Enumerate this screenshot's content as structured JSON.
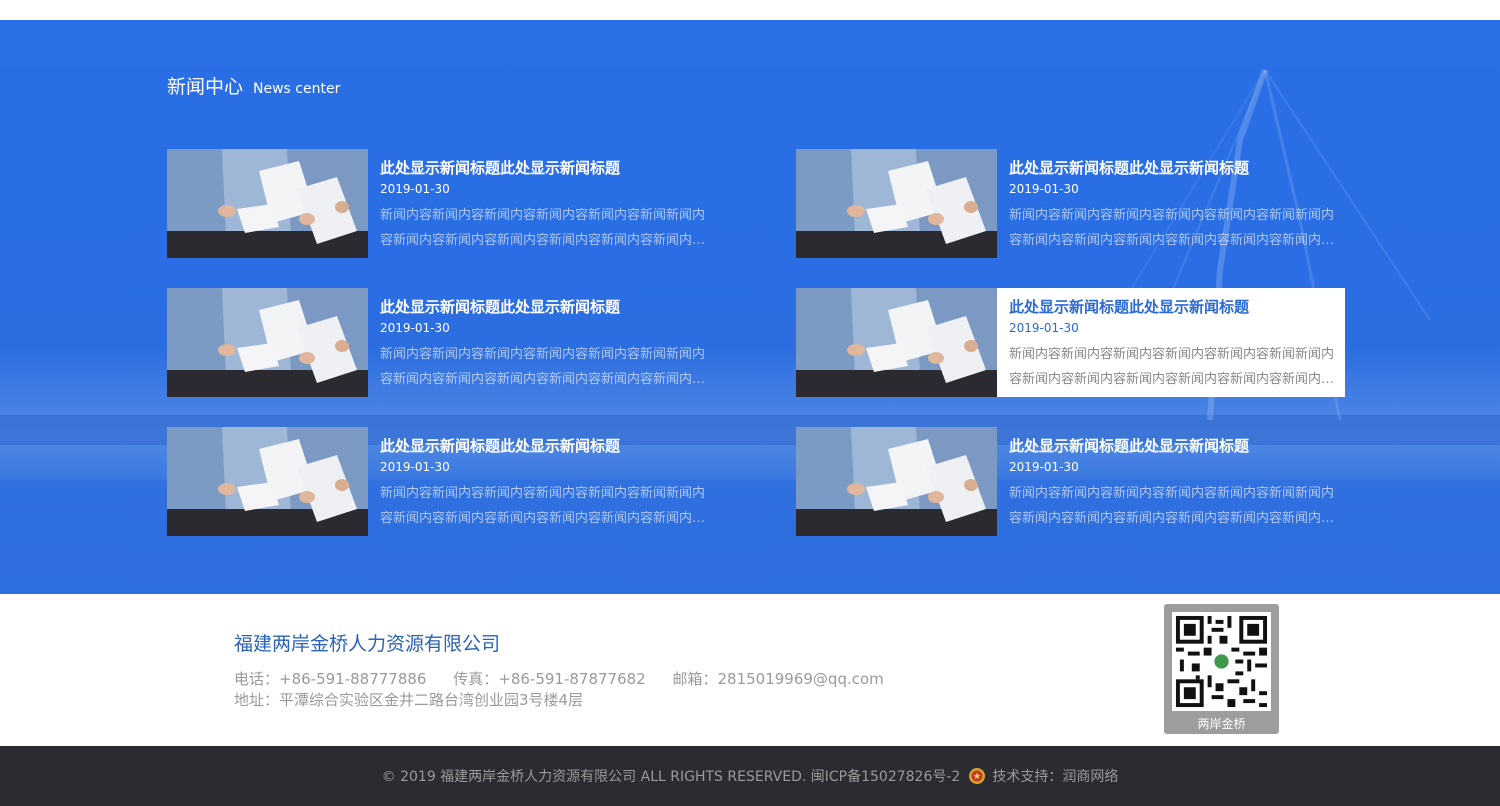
{
  "news": {
    "title_cn": "新闻中心",
    "title_en": "News center",
    "items": [
      {
        "title": "此处显示新闻标题此处显示新闻标题",
        "date": "2019-01-30",
        "summary": "新闻内容新闻内容新闻内容新闻内容新闻内容新闻新闻内容新闻内容新闻内容新闻内容新闻内容新闻内容新闻内容新闻",
        "active": false
      },
      {
        "title": "此处显示新闻标题此处显示新闻标题",
        "date": "2019-01-30",
        "summary": "新闻内容新闻内容新闻内容新闻内容新闻内容新闻新闻内容新闻内容新闻内容新闻内容新闻内容新闻内容新闻内容新闻",
        "active": false
      },
      {
        "title": "此处显示新闻标题此处显示新闻标题",
        "date": "2019-01-30",
        "summary": "新闻内容新闻内容新闻内容新闻内容新闻内容新闻新闻内容新闻内容新闻内容新闻内容新闻内容新闻内容新闻内容新闻",
        "active": false
      },
      {
        "title": "此处显示新闻标题此处显示新闻标题",
        "date": "2019-01-30",
        "summary": "新闻内容新闻内容新闻内容新闻内容新闻内容新闻新闻内容新闻内容新闻内容新闻内容新闻内容新闻内容新闻内容新闻",
        "active": true
      },
      {
        "title": "此处显示新闻标题此处显示新闻标题",
        "date": "2019-01-30",
        "summary": "新闻内容新闻内容新闻内容新闻内容新闻内容新闻新闻内容新闻内容新闻内容新闻内容新闻内容新闻内容新闻内容新闻",
        "active": false
      },
      {
        "title": "此处显示新闻标题此处显示新闻标题",
        "date": "2019-01-30",
        "summary": "新闻内容新闻内容新闻内容新闻内容新闻内容新闻新闻内容新闻内容新闻内容新闻内容新闻内容新闻内容新闻内容新闻",
        "active": false
      }
    ]
  },
  "footer": {
    "company": "福建两岸金桥人力资源有限公司",
    "phone": "电话：+86-591-88777886",
    "fax": "传真：+86-591-87877682",
    "email": "邮箱：2815019969@qq.com",
    "address": "地址：平潭综合实验区金井二路台湾创业园3号楼4层",
    "qr_caption": "两岸金桥"
  },
  "bottom": {
    "copyright": "© 2019 福建两岸金桥人力资源有限公司 ALL RIGHTS RESERVED. 闽ICP备15027826号-2",
    "support": "技术支持：润商网络"
  },
  "colors": {
    "news_bg": "#2a6fe6",
    "accent_text": "#2a6ad8",
    "company_text": "#2a62b8",
    "bottom_bg": "#2b2b31"
  },
  "icons": {
    "badge": "police-badge-icon",
    "qr": "qr-code-icon"
  }
}
